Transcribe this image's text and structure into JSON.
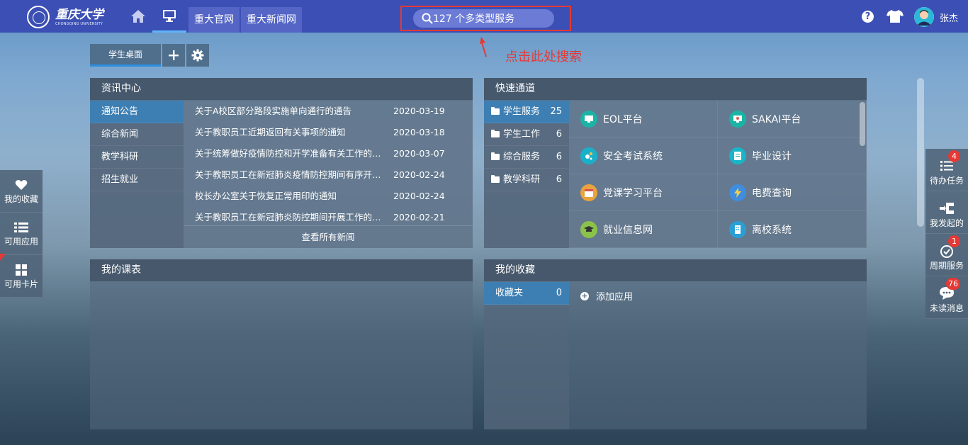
{
  "header": {
    "logo_cn": "重庆大学",
    "logo_en": "CHONGQING UNIVERSITY",
    "links": [
      "重大官网",
      "重大新闻网"
    ],
    "search_label": "127 个多类型服务",
    "help_label": "?",
    "username": "张杰"
  },
  "annotation": {
    "hint": "点击此处搜索"
  },
  "desktop_tabs": {
    "active": "学生桌面"
  },
  "news": {
    "title": "资讯中心",
    "categories": [
      "通知公告",
      "综合新闻",
      "教学科研",
      "招生就业"
    ],
    "items": [
      {
        "title": "关于A校区部分路段实施单向通行的通告",
        "date": "2020-03-19"
      },
      {
        "title": "关于教职员工近期返回有关事项的通知",
        "date": "2020-03-18"
      },
      {
        "title": "关于统筹做好疫情防控和开学准备有关工作的通知",
        "date": "2020-03-07"
      },
      {
        "title": "关于教职员工在新冠肺炎疫情防控期间有序开展工作的通知",
        "date": "2020-02-24"
      },
      {
        "title": "校长办公室关于恢复正常用印的通知",
        "date": "2020-02-24"
      },
      {
        "title": "关于教职员工在新冠肺炎防控期间开展工作的说明",
        "date": "2020-02-21"
      }
    ],
    "more": "查看所有新闻"
  },
  "quick": {
    "title": "快速通道",
    "categories": [
      {
        "label": "学生服务",
        "count": "25"
      },
      {
        "label": "学生工作",
        "count": "6"
      },
      {
        "label": "综合服务",
        "count": "6"
      },
      {
        "label": "教学科研",
        "count": "6"
      }
    ],
    "apps": [
      {
        "label": "EOL平台",
        "icon": "monitor-icon",
        "color": "#1bb3a5"
      },
      {
        "label": "SAKAI平台",
        "icon": "monitor-icon",
        "color": "#1bb3a5"
      },
      {
        "label": "安全考试系统",
        "icon": "molecule-icon",
        "color": "#1ab0c9"
      },
      {
        "label": "毕业设计",
        "icon": "document-icon",
        "color": "#18b6c6"
      },
      {
        "label": "党课学习平台",
        "icon": "calendar-icon",
        "color": "#e8a33c"
      },
      {
        "label": "电费查询",
        "icon": "bolt-icon",
        "color": "#3f8de0"
      },
      {
        "label": "就业信息网",
        "icon": "graduation-cap-icon",
        "color": "#8bc34a"
      },
      {
        "label": "离校系统",
        "icon": "building-icon",
        "color": "#2a9fd6"
      }
    ]
  },
  "schedule": {
    "title": "我的课表"
  },
  "favorites": {
    "title": "我的收藏",
    "folder": {
      "label": "收藏夹",
      "count": "0"
    },
    "add_label": "添加应用"
  },
  "left_float": [
    "我的收藏",
    "可用应用",
    "可用卡片"
  ],
  "right_float": [
    {
      "label": "待办任务",
      "badge": "4"
    },
    {
      "label": "我发起的",
      "badge": ""
    },
    {
      "label": "周期服务",
      "badge": "1"
    },
    {
      "label": "未读消息",
      "badge": "76"
    }
  ],
  "colors": {
    "topbar": "#3b4fb4",
    "accent": "#3e7fb3",
    "alert": "#e53935"
  }
}
